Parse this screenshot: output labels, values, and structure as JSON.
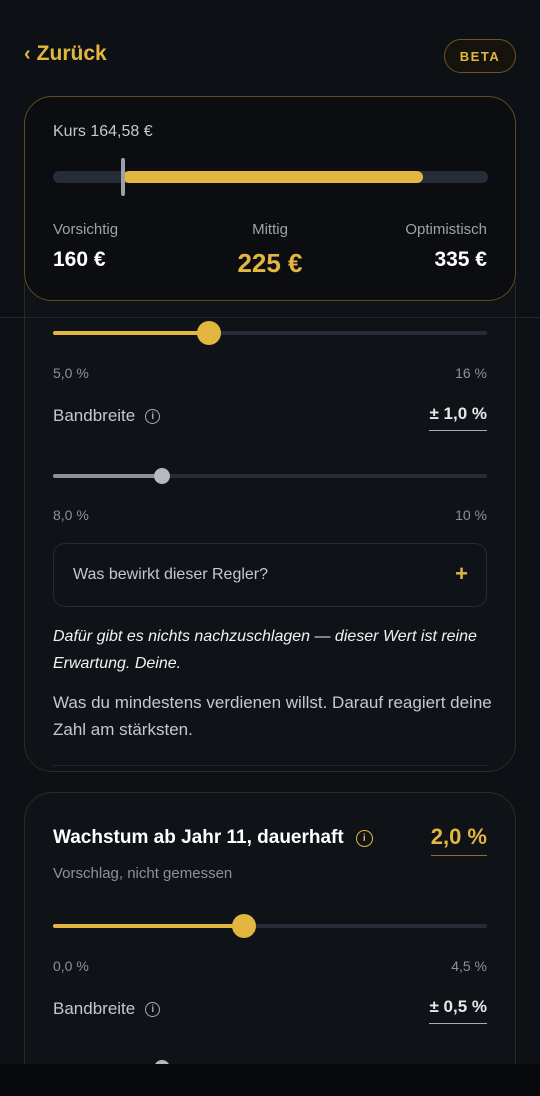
{
  "header": {
    "back_label": "Zurück",
    "badge": "BETA"
  },
  "kurs": {
    "label": "Kurs 164,58 €",
    "current_fraction": 0.16,
    "range_start_fraction": 0.16,
    "range_end_fraction": 0.85,
    "scenarios": [
      {
        "name": "Vorsichtig",
        "value": "160 €"
      },
      {
        "name": "Mittig",
        "value": "225 €"
      },
      {
        "name": "Optimistisch",
        "value": "335 €"
      }
    ]
  },
  "card1": {
    "slider_main": {
      "min": "5,0 %",
      "max": "16 %",
      "fraction": 0.36
    },
    "bandbreite": {
      "label": "Bandbreite",
      "value": "± 1,0 %"
    },
    "slider_band": {
      "min": "8,0 %",
      "max": "10 %",
      "fraction": 0.25
    },
    "faq_question": "Was bewirkt dieser Regler?",
    "faq_icon": "plus-icon",
    "note_italic": "Dafür gibt es nichts nachzuschlagen — dieser Wert ist reine Erwartung. Deine.",
    "note": "Was du mindestens verdienen willst. Darauf reagiert deine Zahl am stärksten."
  },
  "card2": {
    "title": "Wachstum ab Jahr 11, dauerhaft",
    "value": "2,0 %",
    "subtitle": "Vorschlag, nicht gemessen",
    "slider_main": {
      "min": "0,0 %",
      "max": "4,5 %",
      "fraction": 0.44
    },
    "bandbreite": {
      "label": "Bandbreite",
      "value": "± 0,5 %"
    }
  },
  "colors": {
    "accent": "#e3b73f",
    "track": "#262c38",
    "background": "#0d1015"
  }
}
